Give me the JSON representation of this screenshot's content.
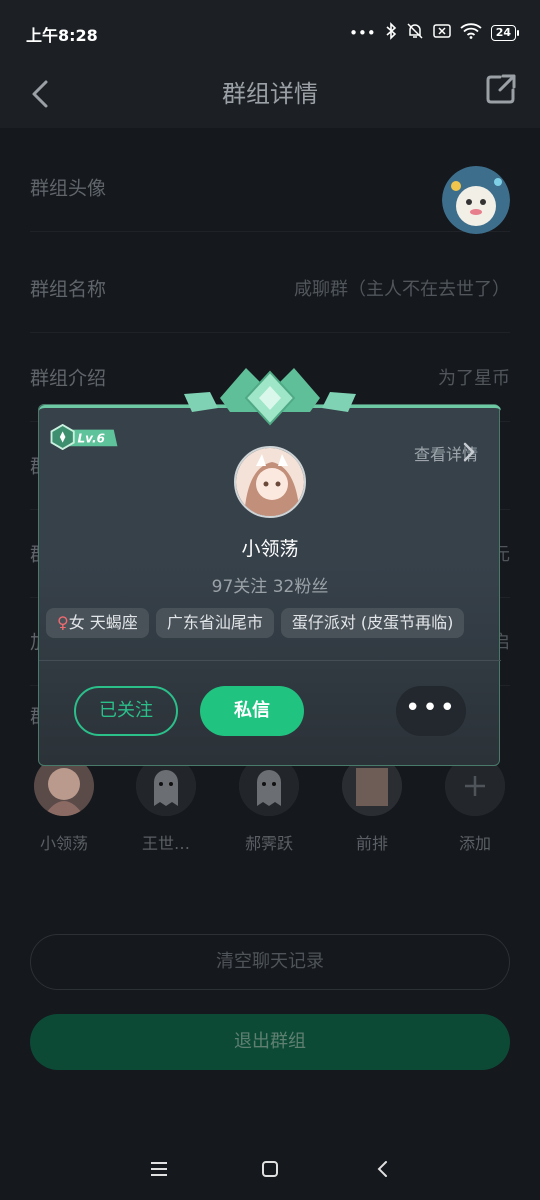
{
  "status_bar": {
    "time": "上午8:28",
    "signal_dots": "•••",
    "battery": "24"
  },
  "header": {
    "title": "群组详情"
  },
  "group": {
    "rows": [
      {
        "label": "群组头像",
        "value": ""
      },
      {
        "label": "群组名称",
        "value": "咸聊群（主人不在去世了）"
      },
      {
        "label": "群组介绍",
        "value": "为了星币"
      },
      {
        "label": "群",
        "value": ""
      },
      {
        "label": "群",
        "value": "元"
      },
      {
        "label": "加",
        "value": "启"
      },
      {
        "label": "群",
        "value": ""
      }
    ]
  },
  "members": [
    {
      "name": "小领荡"
    },
    {
      "name": "王世…"
    },
    {
      "name": "郝霁跃"
    },
    {
      "name": "前排"
    },
    {
      "name": "添加"
    }
  ],
  "buttons": {
    "clear": "清空聊天记录",
    "exit": "退出群组"
  },
  "profile_card": {
    "level": "Lv.6",
    "detail_link": "查看详情",
    "name": "小领荡",
    "stats": "97关注 32粉丝",
    "gender_symbol": "♀",
    "tag_gender_text": "女 天蝎座",
    "tag_location": "广东省汕尾市",
    "tag_game": "蛋仔派对 (皮蛋节再临)",
    "follow_label": "已关注",
    "message_label": "私信",
    "more_label": "•••"
  },
  "colors": {
    "accent": "#21c381",
    "card_bg": "#37414a",
    "page_bg": "#15181c"
  }
}
